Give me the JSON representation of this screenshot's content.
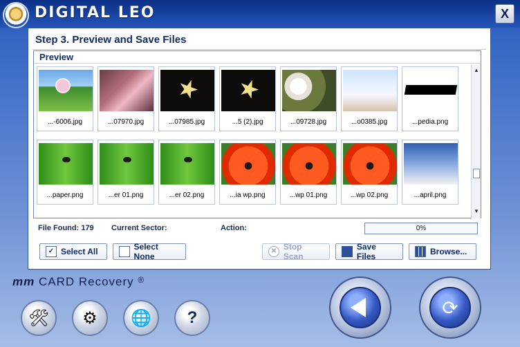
{
  "app": {
    "logo_text": "DIGITAL LEO",
    "brand_text": "CARD Recovery",
    "brand_prefix": "mm",
    "brand_symbol": "®",
    "close_label": "X"
  },
  "panel": {
    "step_title": "Step 3. Preview and Save Files",
    "preview_label": "Preview",
    "thumbnails": [
      {
        "name": "...-6006.jpg"
      },
      {
        "name": "...07970.jpg"
      },
      {
        "name": "...07985.jpg"
      },
      {
        "name": "...5 (2).jpg"
      },
      {
        "name": "...09728.jpg"
      },
      {
        "name": "...o0385.jpg"
      },
      {
        "name": "...pedia.png"
      },
      {
        "name": "...paper.png"
      },
      {
        "name": "...er 01.png"
      },
      {
        "name": "...er 02.png"
      },
      {
        "name": "...ia wp.png"
      },
      {
        "name": "...wp 01.png"
      },
      {
        "name": "...wp 02.png"
      },
      {
        "name": "...april.png"
      }
    ],
    "status": {
      "file_found": "File Found: 179",
      "current_sector": "Current Sector:",
      "action": "Action:",
      "progress": "0%"
    },
    "buttons": {
      "select_all": "Select All",
      "select_none": "Select None",
      "stop_scan": "Stop Scan",
      "save_files": "Save Files",
      "browse": "Browse..."
    }
  }
}
